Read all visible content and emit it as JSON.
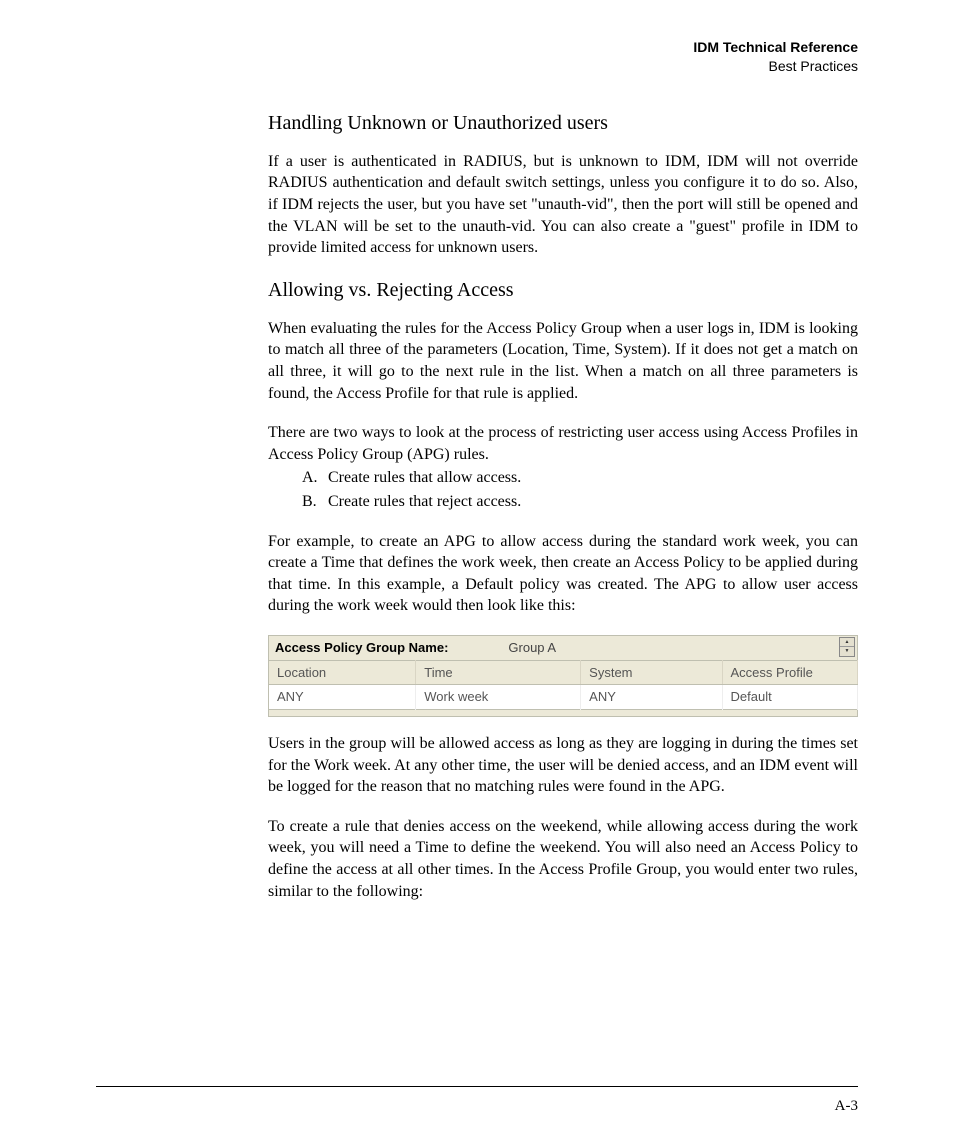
{
  "header": {
    "title": "IDM Technical Reference",
    "subtitle": "Best Practices"
  },
  "sections": {
    "s1": {
      "heading": "Handling Unknown or Unauthorized users",
      "p1": "If a user is authenticated in RADIUS, but is unknown to IDM, IDM will not override RADIUS authentication and default switch settings, unless you configure it to do so. Also, if IDM rejects the user, but you have set \"unauth-vid\", then the port will still be opened and the VLAN will be set to the unauth-vid. You can also create a \"guest\" profile in IDM to provide limited access for unknown users."
    },
    "s2": {
      "heading": "Allowing vs. Rejecting Access",
      "p1": "When evaluating the rules for the Access Policy Group when a user logs in, IDM is looking to match all three of the parameters (Location, Time, System). If it does not get a match on all three, it will go to the next rule in the list. When a match on all three parameters is found, the Access Profile for that rule is applied.",
      "p2": "There are two ways to look at the process of restricting user access using Access Profiles in Access Policy Group (APG) rules.",
      "list": {
        "a_letter": "A.",
        "a_text": "Create rules that allow access.",
        "b_letter": "B.",
        "b_text": "Create rules that reject access."
      },
      "p3": "For example, to create an APG to allow access during the standard work week, you can create a Time that defines the work week, then create an Access Policy to be applied during that time. In this example, a Default policy was created. The APG to allow user access during the work week would then look like this:",
      "p4": "Users in the group will be allowed access as long as they are logging in during the times set for the Work week. At any other time, the user will be denied access, and an IDM event will be logged for the reason that no matching rules were found in the APG.",
      "p5": "To create a rule that denies access on the weekend, while allowing access during the work week, you will need a Time to define the weekend. You will also need an Access Policy to define the access at all other times. In the Access Profile Group, you would enter two rules, similar to the following:"
    }
  },
  "apg": {
    "name_label": "Access Policy Group Name:",
    "name_value": "Group A",
    "columns": {
      "c0": "Location",
      "c1": "Time",
      "c2": "System",
      "c3": "Access Profile"
    },
    "row": {
      "c0": "ANY",
      "c1": "Work week",
      "c2": "ANY",
      "c3": "Default"
    }
  },
  "footer": {
    "page": "A-3"
  }
}
